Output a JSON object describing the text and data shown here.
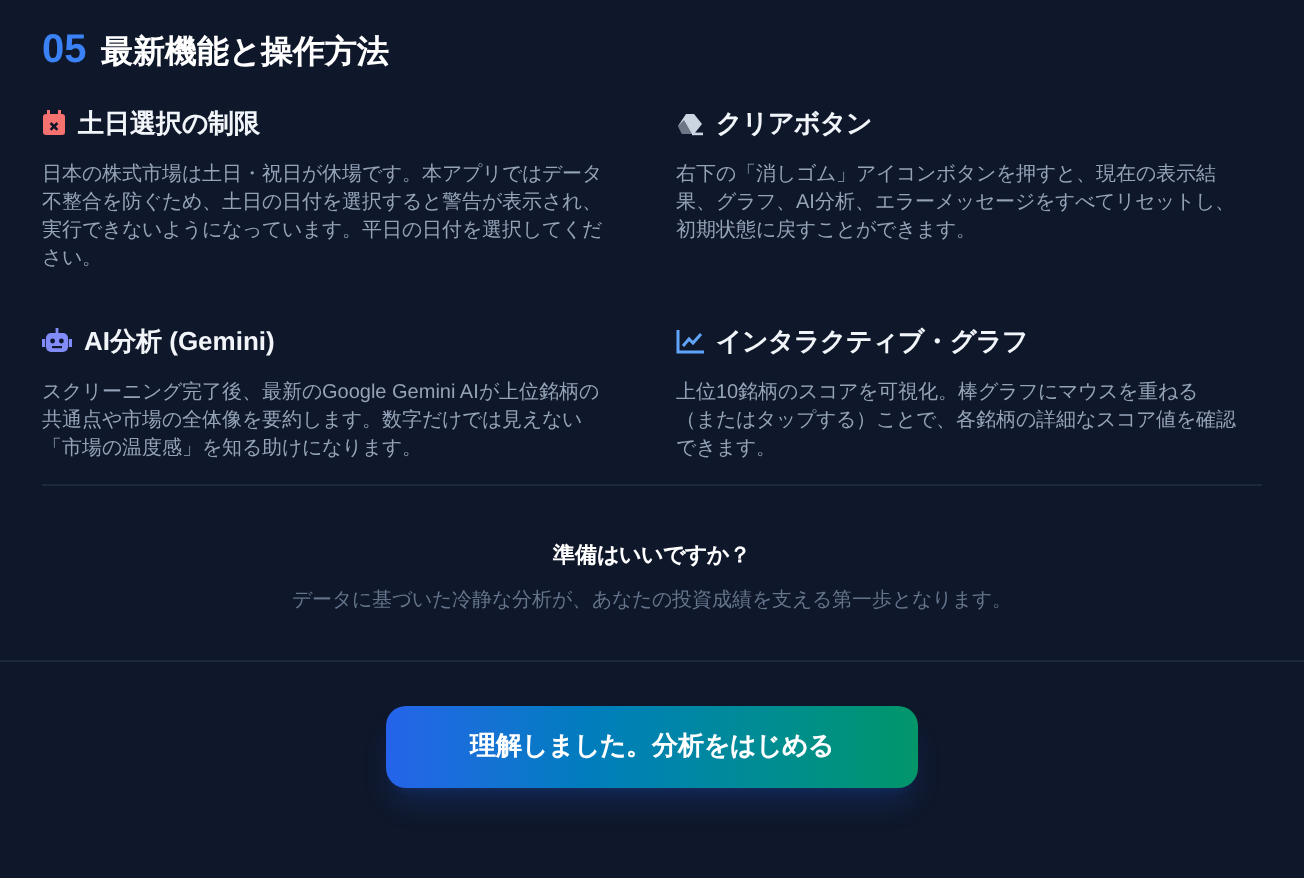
{
  "section": {
    "number": "05",
    "title": "最新機能と操作方法"
  },
  "features": [
    {
      "title": "土日選択の制限",
      "body": "日本の株式市場は土日・祝日が休場です。本アプリではデータ不整合を防ぐため、土日の日付を選択すると警告が表示され、実行できないようになっています。平日の日付を選択してください。"
    },
    {
      "title": "クリアボタン",
      "body": "右下の「消しゴム」アイコンボタンを押すと、現在の表示結果、グラフ、AI分析、エラーメッセージをすべてリセットし、初期状態に戻すことができます。"
    },
    {
      "title": "AI分析 (Gemini)",
      "body": "スクリーニング完了後、最新のGoogle Gemini AIが上位銘柄の共通点や市場の全体像を要約します。数字だけでは見えない「市場の温度感」を知る助けになります。"
    },
    {
      "title": "インタラクティブ・グラフ",
      "body": "上位10銘柄のスコアを可視化。棒グラフにマウスを重ねる（またはタップする）ことで、各銘柄の詳細なスコア値を確認できます。"
    }
  ],
  "closing": {
    "title": "準備はいいですか？",
    "text": "データに基づいた冷静な分析が、あなたの投資成績を支える第一歩となります。"
  },
  "button": "理解しました。分析をはじめる"
}
